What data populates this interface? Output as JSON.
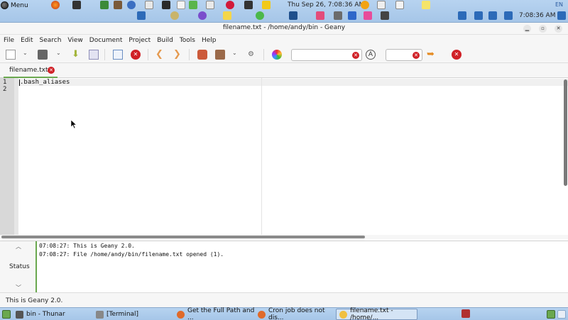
{
  "top_panel": {
    "menu_label": "Menu",
    "clock": "Thu Sep 26,  7:08:36 AM",
    "clock_short": "7:08:36 AM",
    "keyboard_layout": "EN"
  },
  "window": {
    "title": "filename.txt - /home/andy/bin - Geany"
  },
  "menubar": [
    "File",
    "Edit",
    "Search",
    "View",
    "Document",
    "Project",
    "Build",
    "Tools",
    "Help"
  ],
  "toolbar": {
    "search_value": "",
    "goto_value": ""
  },
  "tabs": [
    {
      "label": "filename.txt"
    }
  ],
  "editor": {
    "line_numbers": [
      "1",
      "2"
    ],
    "lines": [
      ".bash_aliases",
      ""
    ]
  },
  "message_panel": {
    "tab_label": "Status",
    "messages": [
      "07:08:27: This is Geany 2.0.",
      "07:08:27: File /home/andy/bin/filename.txt opened (1)."
    ]
  },
  "statusbar": {
    "text": "This is Geany 2.0."
  },
  "taskbar": {
    "items": [
      {
        "label": "bin - Thunar"
      },
      {
        "label": "[Terminal]"
      },
      {
        "label": "Get the Full Path and ..."
      },
      {
        "label": "Cron job does not dis..."
      },
      {
        "label": "filename.txt - /home/..."
      }
    ]
  },
  "colors": {
    "accent_green": "#6aa84f",
    "close_red": "#d02026",
    "panel_blue": "#a6c6e8"
  }
}
